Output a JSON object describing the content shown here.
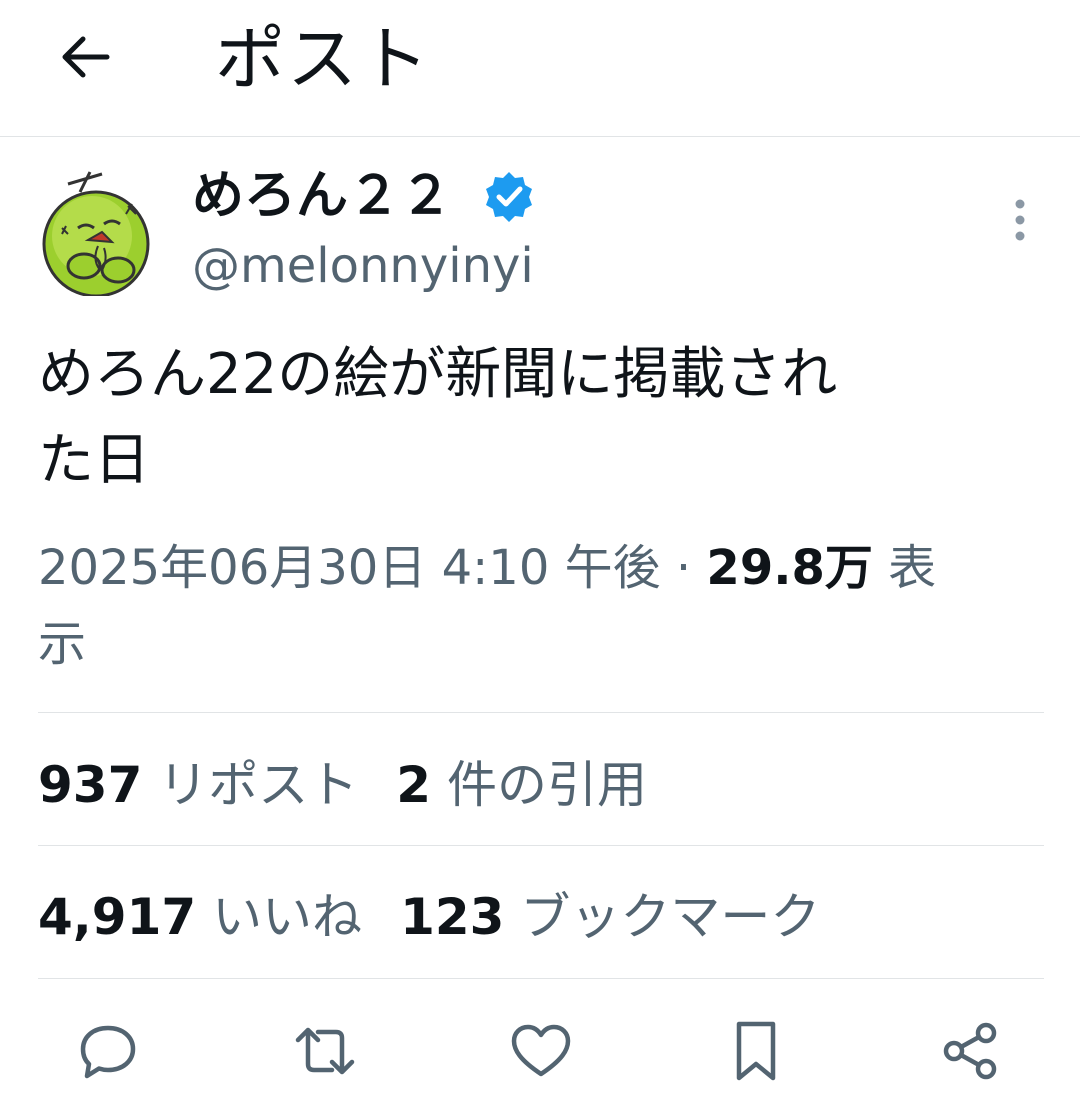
{
  "header": {
    "back_icon": "arrow-left-icon",
    "title": "ポスト"
  },
  "author": {
    "name": "めろん２２",
    "handle": "@melonnyinyi",
    "verified_icon": "verified-badge-icon",
    "verified_color": "#1d9bf0"
  },
  "post": {
    "text_line1": "めろん22の絵が新聞に掲載され",
    "text_line2": "た日",
    "timestamp": "2025年06月30日 4:10 午後",
    "separator": "·",
    "views_count": "29.8万",
    "views_label_line1": "表",
    "views_label_line2": "示"
  },
  "stats": {
    "reposts_count": "937",
    "reposts_label": "リポスト",
    "quotes_count": "2",
    "quotes_label": "件の引用",
    "likes_count": "4,917",
    "likes_label": "いいね",
    "bookmarks_count": "123",
    "bookmarks_label": "ブックマーク"
  },
  "actions": {
    "reply_icon": "reply-icon",
    "repost_icon": "repost-icon",
    "like_icon": "heart-icon",
    "bookmark_icon": "bookmark-icon",
    "share_icon": "share-icon"
  },
  "colors": {
    "text_primary": "#0f1419",
    "text_secondary": "#536471",
    "divider": "#e1e4e6"
  }
}
